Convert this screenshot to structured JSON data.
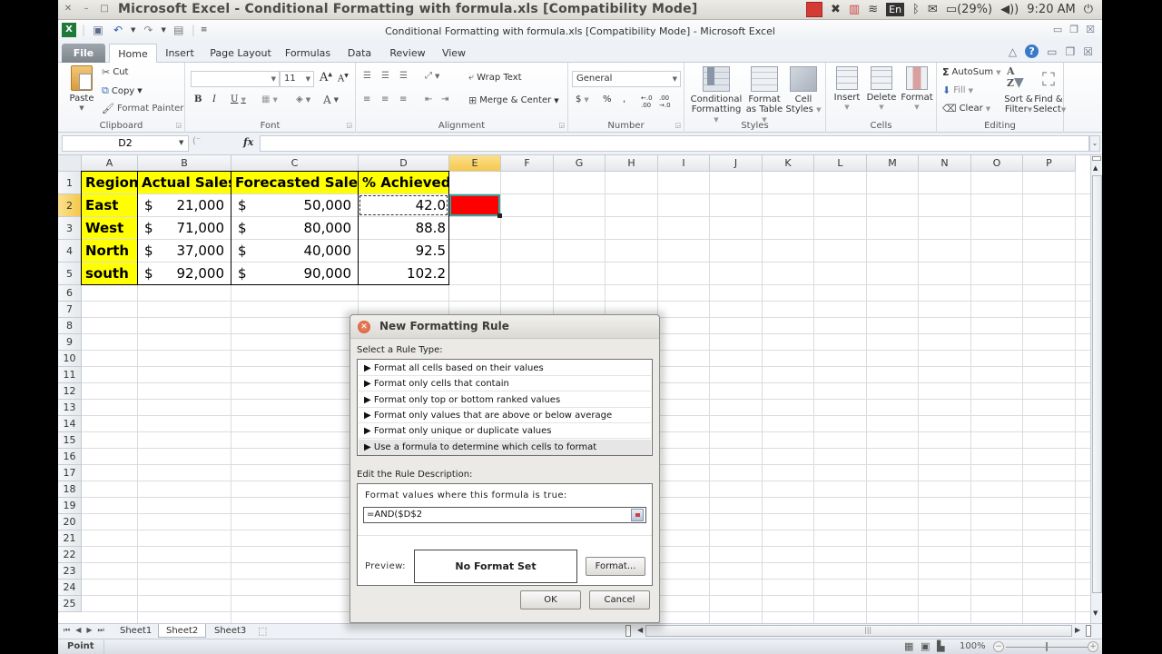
{
  "top_panel": {
    "window_title": "Microsoft Excel - Conditional Formatting with formula.xls  [Compatibility Mode]",
    "keyboard_layout": "En",
    "battery": "(29%)",
    "clock": "9:20 AM"
  },
  "excel": {
    "title": "Conditional Formatting with formula.xls  [Compatibility Mode]  -  Microsoft Excel",
    "tabs": [
      {
        "label": "File"
      },
      {
        "label": "Home"
      },
      {
        "label": "Insert"
      },
      {
        "label": "Page Layout"
      },
      {
        "label": "Formulas"
      },
      {
        "label": "Data"
      },
      {
        "label": "Review"
      },
      {
        "label": "View"
      }
    ],
    "ribbon": {
      "clipboard": {
        "label": "Clipboard",
        "paste": "Paste",
        "cut": "Cut",
        "copy": "Copy",
        "format_painter": "Format Painter"
      },
      "font": {
        "label": "Font",
        "font_name": "",
        "font_size": "11",
        "bold": "B",
        "italic": "I",
        "underline": "U"
      },
      "alignment": {
        "label": "Alignment",
        "wrap_text": "Wrap Text",
        "merge_center": "Merge & Center"
      },
      "number": {
        "label": "Number",
        "format": "General",
        "currency": "$",
        "percent": "%",
        "comma": ","
      },
      "styles": {
        "label": "Styles",
        "conditional_formatting": [
          "Conditional",
          "Formatting"
        ],
        "format_as_table": [
          "Format",
          "as Table"
        ],
        "cell_styles": [
          "Cell",
          "Styles"
        ]
      },
      "cells": {
        "label": "Cells",
        "insert": "Insert",
        "delete": "Delete",
        "format": "Format"
      },
      "editing": {
        "label": "Editing",
        "autosum": "AutoSum",
        "fill": "Fill",
        "clear": "Clear",
        "sort_filter": [
          "Sort &",
          "Filter"
        ],
        "find_select": [
          "Find &",
          "Select"
        ]
      }
    },
    "formula_bar": {
      "name_box": "D2",
      "fx": "fx",
      "formula": ""
    },
    "columns": [
      "A",
      "B",
      "C",
      "D",
      "E",
      "F",
      "G",
      "H",
      "I",
      "J",
      "K",
      "L",
      "M",
      "N",
      "O",
      "P"
    ],
    "active_column": "E",
    "active_row": "2",
    "rows": [
      "1",
      "2",
      "3",
      "4",
      "5",
      "6",
      "7",
      "8",
      "9",
      "10",
      "11",
      "12",
      "13",
      "14",
      "15",
      "16",
      "17",
      "18",
      "19",
      "20",
      "21",
      "22",
      "23",
      "24",
      "25"
    ],
    "sheet": {
      "headers": [
        "Region",
        "Actual Sales",
        "Forecasted Sales",
        "% Achieved"
      ],
      "data": [
        {
          "region": "East",
          "actual_cur": "$",
          "actual": "21,000",
          "forecast_cur": "$",
          "forecast": "50,000",
          "pct": "42.0"
        },
        {
          "region": "West",
          "actual_cur": "$",
          "actual": "71,000",
          "forecast_cur": "$",
          "forecast": "80,000",
          "pct": "88.8"
        },
        {
          "region": "North",
          "actual_cur": "$",
          "actual": "37,000",
          "forecast_cur": "$",
          "forecast": "40,000",
          "pct": "92.5"
        },
        {
          "region": "south",
          "actual_cur": "$",
          "actual": "92,000",
          "forecast_cur": "$",
          "forecast": "90,000",
          "pct": "102.2"
        }
      ],
      "highlight_fill": "#ff0000",
      "header_fill": "#ffff00"
    },
    "sheet_tabs": [
      "Sheet1",
      "Sheet2",
      "Sheet3"
    ],
    "active_sheet": "Sheet2",
    "status": {
      "mode": "Point",
      "zoom": "100%"
    }
  },
  "dialog": {
    "title": "New Formatting Rule",
    "select_label": "Select a Rule Type:",
    "rule_types": [
      "▶  Format all cells based on their values",
      "▶  Format only cells that contain",
      "▶  Format only top or bottom ranked values",
      "▶  Format only values that are above or below average",
      "▶  Format only unique or duplicate values",
      "▶  Use a formula to determine which cells to format"
    ],
    "selected_rule_index": 5,
    "edit_label": "Edit the Rule Description:",
    "formula_label": "Format values where this formula is true:",
    "formula_value": "=AND($D$2",
    "preview_label": "Preview:",
    "preview_text": "No Format Set",
    "format_button": "Format...",
    "ok_button": "OK",
    "cancel_button": "Cancel"
  }
}
